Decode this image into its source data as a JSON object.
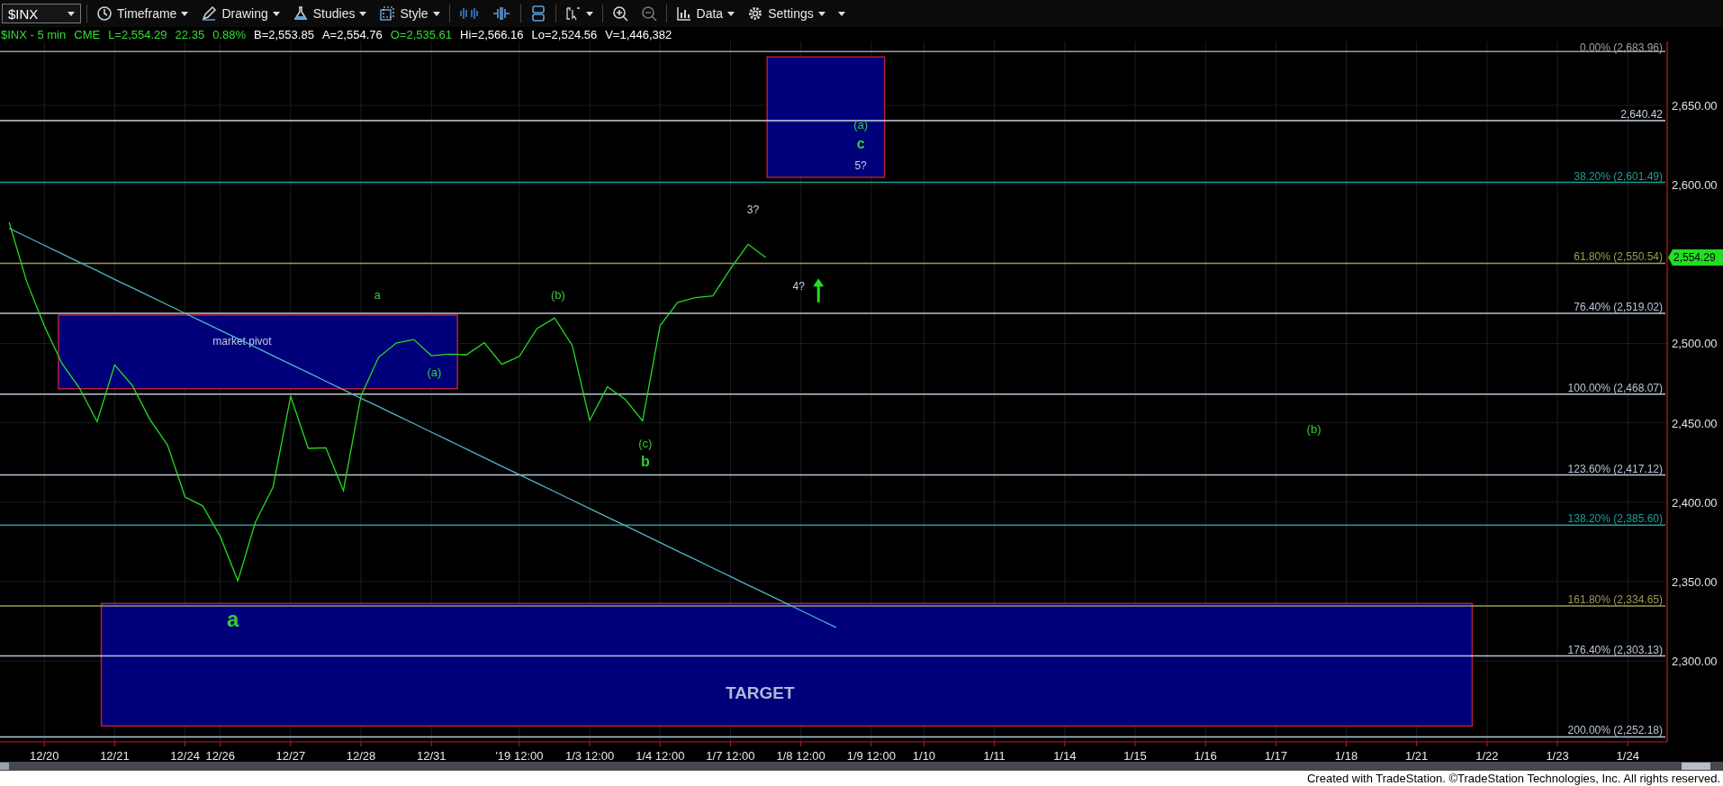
{
  "toolbar": [
    {
      "kind": "symbol",
      "value": "$INX",
      "dropdown": true
    },
    {
      "kind": "menu",
      "label": "Timeframe",
      "dropdown": true
    },
    {
      "kind": "menu",
      "label": "Drawing",
      "dropdown": true
    },
    {
      "kind": "menu",
      "label": "Studies",
      "dropdown": true
    },
    {
      "kind": "menu",
      "label": "Style",
      "dropdown": true
    },
    {
      "kind": "tool",
      "dropdown": false
    },
    {
      "kind": "tool",
      "dropdown": false
    },
    {
      "kind": "tool",
      "dropdown": false
    },
    {
      "kind": "tool",
      "dropdown": true
    },
    {
      "kind": "tool",
      "dropdown": false
    },
    {
      "kind": "tool",
      "dropdown": false
    },
    {
      "kind": "menu",
      "label": "Data",
      "dropdown": true
    },
    {
      "kind": "menu",
      "label": "Settings",
      "dropdown": true
    },
    {
      "kind": "tool",
      "dropdown": true
    }
  ],
  "quote_line": [
    {
      "text": "$INX - 5 min",
      "color": "#33dd33"
    },
    {
      "text": "CME",
      "color": "#33dd33"
    },
    {
      "text": "L=2,554.29",
      "color": "#33dd33"
    },
    {
      "text": "22.35",
      "color": "#33dd33"
    },
    {
      "text": "0.88%",
      "color": "#33dd33"
    },
    {
      "text": "B=2,553.85",
      "color": "#ffffff"
    },
    {
      "text": "A=2,554.76",
      "color": "#ffffff"
    },
    {
      "text": "O=2,535.61",
      "color": "#33dd33"
    },
    {
      "text": "Hi=2,566.16",
      "color": "#ffffff"
    },
    {
      "text": "Lo=2,524.56",
      "color": "#ffffff"
    },
    {
      "text": "V=1,446,382",
      "color": "#ffffff"
    }
  ],
  "chart": {
    "last_price_tag": "2,554.29",
    "chart_data": {
      "type": "line",
      "grid": true,
      "categories": [
        null,
        null,
        "12/20",
        null,
        null,
        null,
        "12/21",
        null,
        null,
        null,
        "12/24",
        null,
        "12/26",
        null,
        null,
        null,
        "12/27",
        null,
        null,
        null,
        "12/28",
        null,
        null,
        null,
        "12/31",
        null,
        null,
        null,
        null,
        "'19 12:00",
        null,
        null,
        null,
        "1/3 12:00",
        null,
        null,
        null,
        "1/4 12:00",
        null,
        null,
        null,
        "1/7 12:00",
        null,
        null,
        null,
        "1/8 12:00",
        null,
        null,
        null,
        "1/9 12:00",
        null,
        null,
        "1/10",
        null,
        null,
        null,
        "1/11",
        null,
        null,
        null,
        "1/14",
        null,
        null,
        null,
        "1/15",
        null,
        null,
        null,
        "1/16",
        null,
        null,
        null,
        "1/17",
        null,
        null,
        null,
        "1/18",
        null,
        null,
        null,
        "1/21",
        null,
        null,
        null,
        "1/22",
        null,
        null,
        null,
        "1/23",
        null,
        null,
        null,
        "1/24",
        null,
        null
      ],
      "series": [
        {
          "color": "#22dd22",
          "values": [
            2576.3,
            2538.9,
            2511.1,
            2487.4,
            2471.9,
            2450.7,
            2486.5,
            2473.5,
            2452.1,
            2436.0,
            2403.3,
            2397.7,
            2378.4,
            2350.5,
            2387.6,
            2409.5,
            2466.7,
            2433.9,
            2434.3,
            2407.3,
            2467.0,
            2491.3,
            2500.2,
            2502.5,
            2492.3,
            2493.3,
            2492.9,
            2500.5,
            2486.9,
            2491.9,
            2509.4,
            2516.1,
            2498.9,
            2451.5,
            2472.7,
            2465.0,
            2451.2,
            2511.3,
            2525.9,
            2528.8,
            2530.0,
            2547.2,
            2562.5,
            2554.1,
            null,
            null,
            null,
            null,
            null,
            null,
            null,
            null,
            null,
            null,
            null,
            null,
            null,
            null,
            null,
            null,
            null,
            null,
            null,
            null,
            null,
            null,
            null,
            null,
            null,
            null,
            null,
            null,
            null,
            null,
            null,
            null,
            null,
            null,
            null,
            null,
            null,
            null,
            null,
            null,
            null,
            null,
            null,
            null,
            null,
            null,
            null,
            null,
            null,
            null,
            null
          ]
        },
        {
          "color": "#4fb3c8",
          "values": [
            2572.5,
            2567.2,
            2561.8,
            2556.5,
            2551.1,
            2545.8,
            2540.4,
            2535.1,
            2529.7,
            2524.4,
            2519.0,
            2513.7,
            2508.3,
            2503.0,
            2497.6,
            2492.3,
            2486.9,
            2481.6,
            2476.2,
            2470.9,
            2465.5,
            2460.2,
            2454.8,
            2449.5,
            2444.1,
            2438.8,
            2433.4,
            2428.1,
            2422.7,
            2417.4,
            2412.0,
            2406.7,
            2401.3,
            2396.0,
            2390.6,
            2385.3,
            2379.9,
            2374.6,
            2369.2,
            2363.9,
            2358.5,
            2353.2,
            2347.8,
            2342.5,
            2337.1,
            2331.8,
            2326.4,
            2321.1,
            null,
            null,
            null,
            null,
            null,
            null,
            null,
            null,
            null,
            null,
            null,
            null,
            null,
            null,
            null,
            null,
            null,
            null,
            null,
            null,
            null,
            null,
            null,
            null,
            null,
            null,
            null,
            null,
            null,
            null,
            null,
            null,
            null,
            null,
            null,
            null,
            null,
            null,
            null,
            null,
            null,
            null,
            null,
            null,
            null,
            null,
            null
          ]
        }
      ],
      "ylim": [
        2249.0,
        2690.3
      ],
      "yticks": [
        {
          "value": 2300,
          "label": "2,300.00"
        },
        {
          "value": 2350,
          "label": "2,350.00"
        },
        {
          "value": 2400,
          "label": "2,400.00"
        },
        {
          "value": 2450,
          "label": "2,450.00"
        },
        {
          "value": 2500,
          "label": "2,500.00"
        },
        {
          "value": 2600,
          "label": "2,600.00"
        },
        {
          "value": 2650,
          "label": "2,650.00"
        }
      ],
      "ref_lines": [
        {
          "axis": "y",
          "value": 2683.96,
          "label": "0.00% (2,683.96)",
          "color": "#a0a0a0"
        },
        {
          "axis": "y",
          "value": 2640.42,
          "label": "2,640.42",
          "color": "#c8d0e0"
        },
        {
          "axis": "y",
          "value": 2601.49,
          "label": "38.20% (2,601.49)",
          "color": "#1f9e96"
        },
        {
          "axis": "y",
          "value": 2550.54,
          "label": "61.80% (2,550.54)",
          "color": "#9a9a55"
        },
        {
          "axis": "y",
          "value": 2519.02,
          "label": "76.40% (2,519.02)",
          "color": "#b8c4d8"
        },
        {
          "axis": "y",
          "value": 2468.07,
          "label": "100.00% (2,468.07)",
          "color": "#b8c4d8"
        },
        {
          "axis": "y",
          "value": 2417.12,
          "label": "123.60% (2,417.12)",
          "color": "#b8c4d8"
        },
        {
          "axis": "y",
          "value": 2385.6,
          "label": "138.20% (2,385.60)",
          "color": "#1f9e96"
        },
        {
          "axis": "y",
          "value": 2334.65,
          "label": "161.80% (2,334.65)",
          "color": "#9a9a55"
        },
        {
          "axis": "y",
          "value": 2303.13,
          "label": "176.40% (2,303.13)",
          "color": "#b8c4d8"
        },
        {
          "axis": "y",
          "value": 2252.18,
          "label": "200.00% (2,252.18)",
          "color": "#b8c4d8"
        }
      ],
      "annotations": [
        "market pivot",
        "TARGET",
        "a",
        "a",
        "(a)",
        "(b)",
        "(c)",
        "b",
        "3?",
        "4?",
        "(a)",
        "c",
        "5?",
        "(b)"
      ]
    }
  },
  "footer": {
    "text": "Created with TradeStation. ©TradeStation Technologies, Inc. All rights reserved."
  }
}
